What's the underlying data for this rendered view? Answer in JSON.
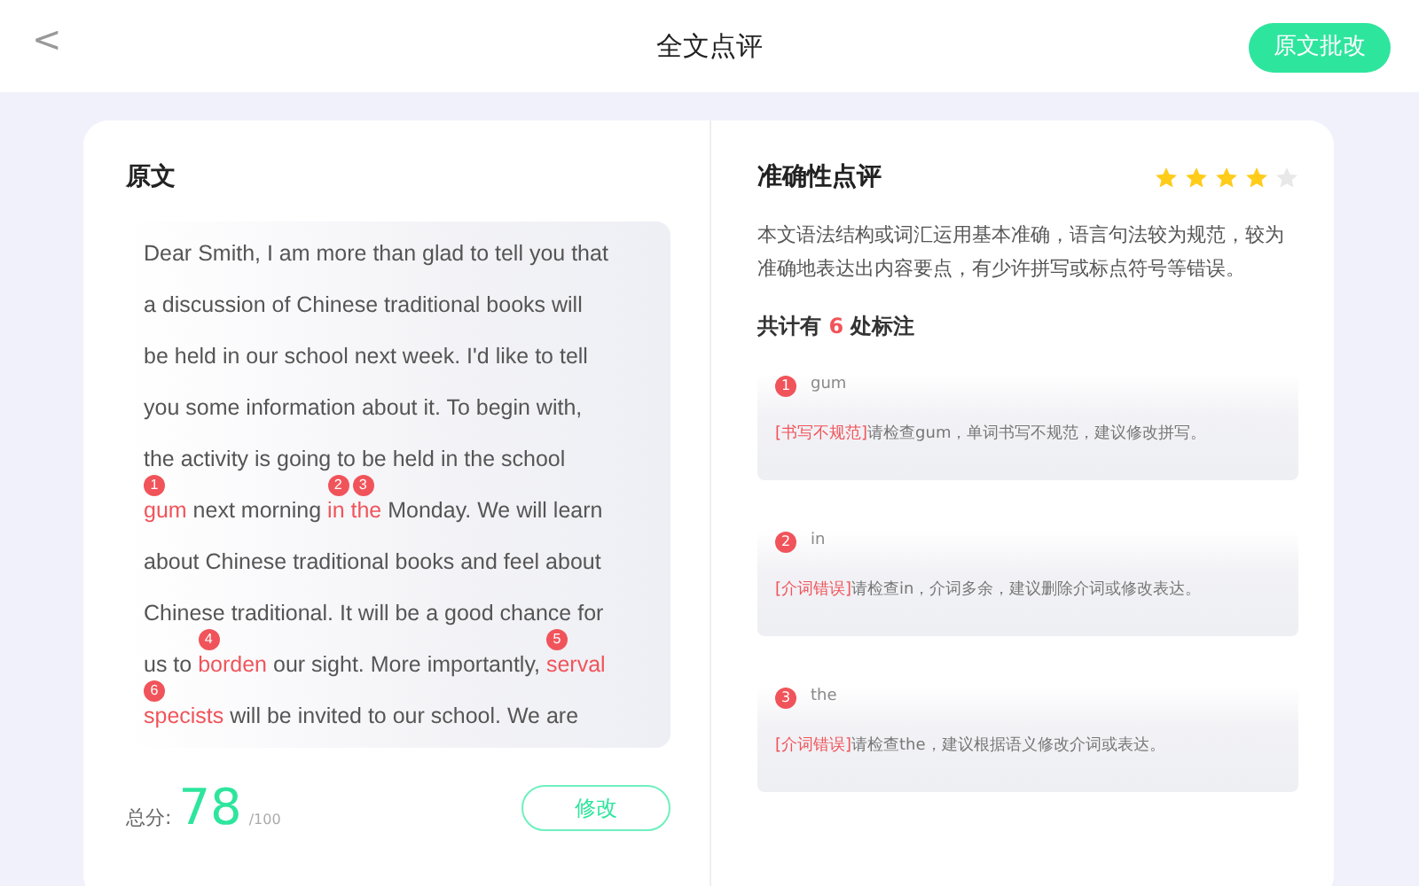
{
  "header": {
    "back": "<",
    "title": "全文点评",
    "action": "原文批改"
  },
  "original": {
    "title": "原文",
    "lines": [
      [
        {
          "kind": "plain",
          "text": "Dear Smith, I am more than glad to tell you that"
        }
      ],
      [
        {
          "kind": "plain",
          "text": "a discussion of Chinese traditional books will"
        }
      ],
      [
        {
          "kind": "plain",
          "text": "be held in our school next week. I'd like to tell"
        }
      ],
      [
        {
          "kind": "plain",
          "text": "you some information about it. To begin with,"
        }
      ],
      [
        {
          "kind": "plain",
          "text": "the activity is going to be held in the school"
        }
      ],
      [
        {
          "kind": "mark",
          "text": "gum",
          "marks": [
            "1"
          ]
        },
        {
          "kind": "plain",
          "text": " next morning "
        },
        {
          "kind": "mark",
          "text": "in the",
          "marks": [
            "2",
            "3"
          ]
        },
        {
          "kind": "plain",
          "text": " Monday. We will learn"
        }
      ],
      [
        {
          "kind": "plain",
          "text": "about Chinese traditional books and feel about"
        }
      ],
      [
        {
          "kind": "plain",
          "text": "Chinese traditional. It will be a good chance for"
        }
      ],
      [
        {
          "kind": "plain",
          "text": "us to "
        },
        {
          "kind": "mark",
          "text": "borden",
          "marks": [
            "4"
          ]
        },
        {
          "kind": "plain",
          "text": " our sight. More importantly, "
        },
        {
          "kind": "mark",
          "text": "serval",
          "marks": [
            "5"
          ]
        }
      ],
      [
        {
          "kind": "mark",
          "text": "specists",
          "marks": [
            "6"
          ]
        },
        {
          "kind": "plain",
          "text": " will be invited to our school. We are"
        }
      ]
    ],
    "score_label": "总分:",
    "score": "78",
    "score_max": "/100",
    "edit": "修改"
  },
  "review": {
    "title": "准确性点评",
    "stars": 4,
    "summary": "本文语法结构或词汇运用基本准确，语言句法较为规范，较为准确地表达出内容要点，有少许拼写或标点符号等错误。",
    "count_before": "共计有",
    "count": "6",
    "count_after": "处标注",
    "items": [
      {
        "number": "1",
        "word": "gum",
        "tag": "[书写不规范]",
        "text": "请检查gum，单词书写不规范，建议修改拼写。"
      },
      {
        "number": "2",
        "word": "in",
        "tag": "[介词错误]",
        "text": "请检查in，介词多余，建议删除介词或修改表达。"
      },
      {
        "number": "3",
        "word": "the",
        "tag": "[介词错误]",
        "text": "请检查the，建议根据语义修改介词或表达。"
      }
    ]
  }
}
